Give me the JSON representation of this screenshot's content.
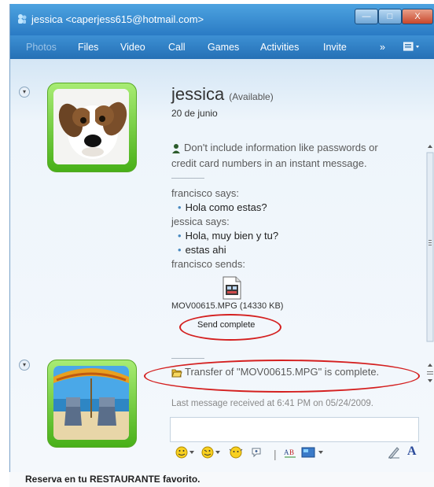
{
  "window": {
    "title": "jessica <caperjess615@hotmail.com>",
    "controls": {
      "minimize": "—",
      "maximize": "□",
      "close": "X"
    }
  },
  "menu": {
    "items": [
      "Photos",
      "Files",
      "Video",
      "Call",
      "Games",
      "Activities",
      "Invite"
    ],
    "overflow": "»"
  },
  "contact": {
    "name": "jessica",
    "status": "(Available)",
    "date": "20 de junio"
  },
  "conversation": {
    "warning": "Don't include information like passwords or credit card numbers in an instant message.",
    "warning_line1": "Don't include information like passwords or",
    "warning_line2": "credit card numbers in an instant message.",
    "messages": [
      {
        "speaker": "francisco says:",
        "lines": [
          "Hola como estas?"
        ]
      },
      {
        "speaker": "jessica says:",
        "lines": [
          "Hola, muy bien y tu?",
          "estas ahi"
        ]
      },
      {
        "speaker": "francisco sends:",
        "lines": []
      }
    ],
    "file_name": "MOV00615.MPG (14330 KB)",
    "send_status": "Send complete"
  },
  "transfer": {
    "notice": "Transfer of \"MOV00615.MPG\" is complete.",
    "last_message": "Last message received at 6:41 PM on 05/24/2009."
  },
  "toolbar": {
    "font_label": "A"
  },
  "statusbar": {
    "ad_text": "Reserva en tu RESTAURANTE favorito."
  },
  "colors": {
    "titlebar": "#2a7bc4",
    "menubar": "#2570b5",
    "highlight_ellipse": "#d42020",
    "avatar_frame": "#48b018"
  }
}
